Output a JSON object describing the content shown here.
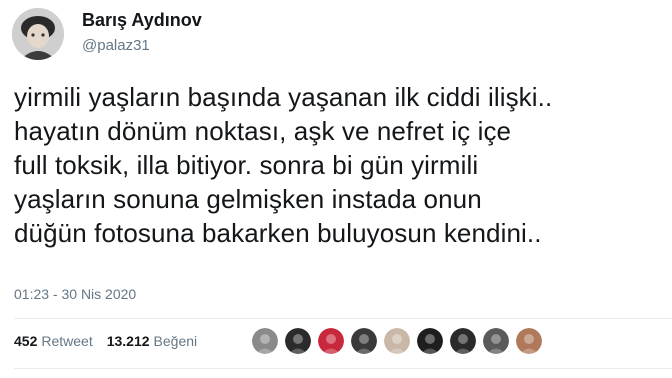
{
  "author": {
    "name": "Barış Aydınov",
    "handle": "@palaz31"
  },
  "tweet": {
    "lines": [
      "yirmili yaşların başında yaşanan ilk ciddi ilişki..",
      "hayatın dönüm noktası, aşk ve nefret iç içe",
      "full toksik, illa bitiyor. sonra bi gün yirmili",
      "yaşların sonuna gelmişken instada onun",
      "düğün fotosuna bakarken buluyosun kendini.."
    ],
    "timestamp": "01:23 - 30 Nis 2020"
  },
  "stats": {
    "retweets_count": "452",
    "retweets_label": "Retweet",
    "likes_count": "13.212",
    "likes_label": "Beğeni"
  },
  "likers": [
    {
      "icon": "liker-avatar",
      "color": "#8a8a8a"
    },
    {
      "icon": "liker-avatar",
      "color": "#2b2b2b"
    },
    {
      "icon": "liker-avatar",
      "color": "#c8283c"
    },
    {
      "icon": "liker-avatar",
      "color": "#3a3a3a"
    },
    {
      "icon": "liker-avatar",
      "color": "#c9b8a8"
    },
    {
      "icon": "liker-avatar",
      "color": "#1e1e1e"
    },
    {
      "icon": "liker-avatar",
      "color": "#2a2a2a"
    },
    {
      "icon": "liker-avatar",
      "color": "#5a5a5a"
    },
    {
      "icon": "liker-avatar",
      "color": "#b07a5a"
    }
  ],
  "colors": {
    "text": "#14171a",
    "secondary": "#657786",
    "divider": "#e6ecf0"
  }
}
